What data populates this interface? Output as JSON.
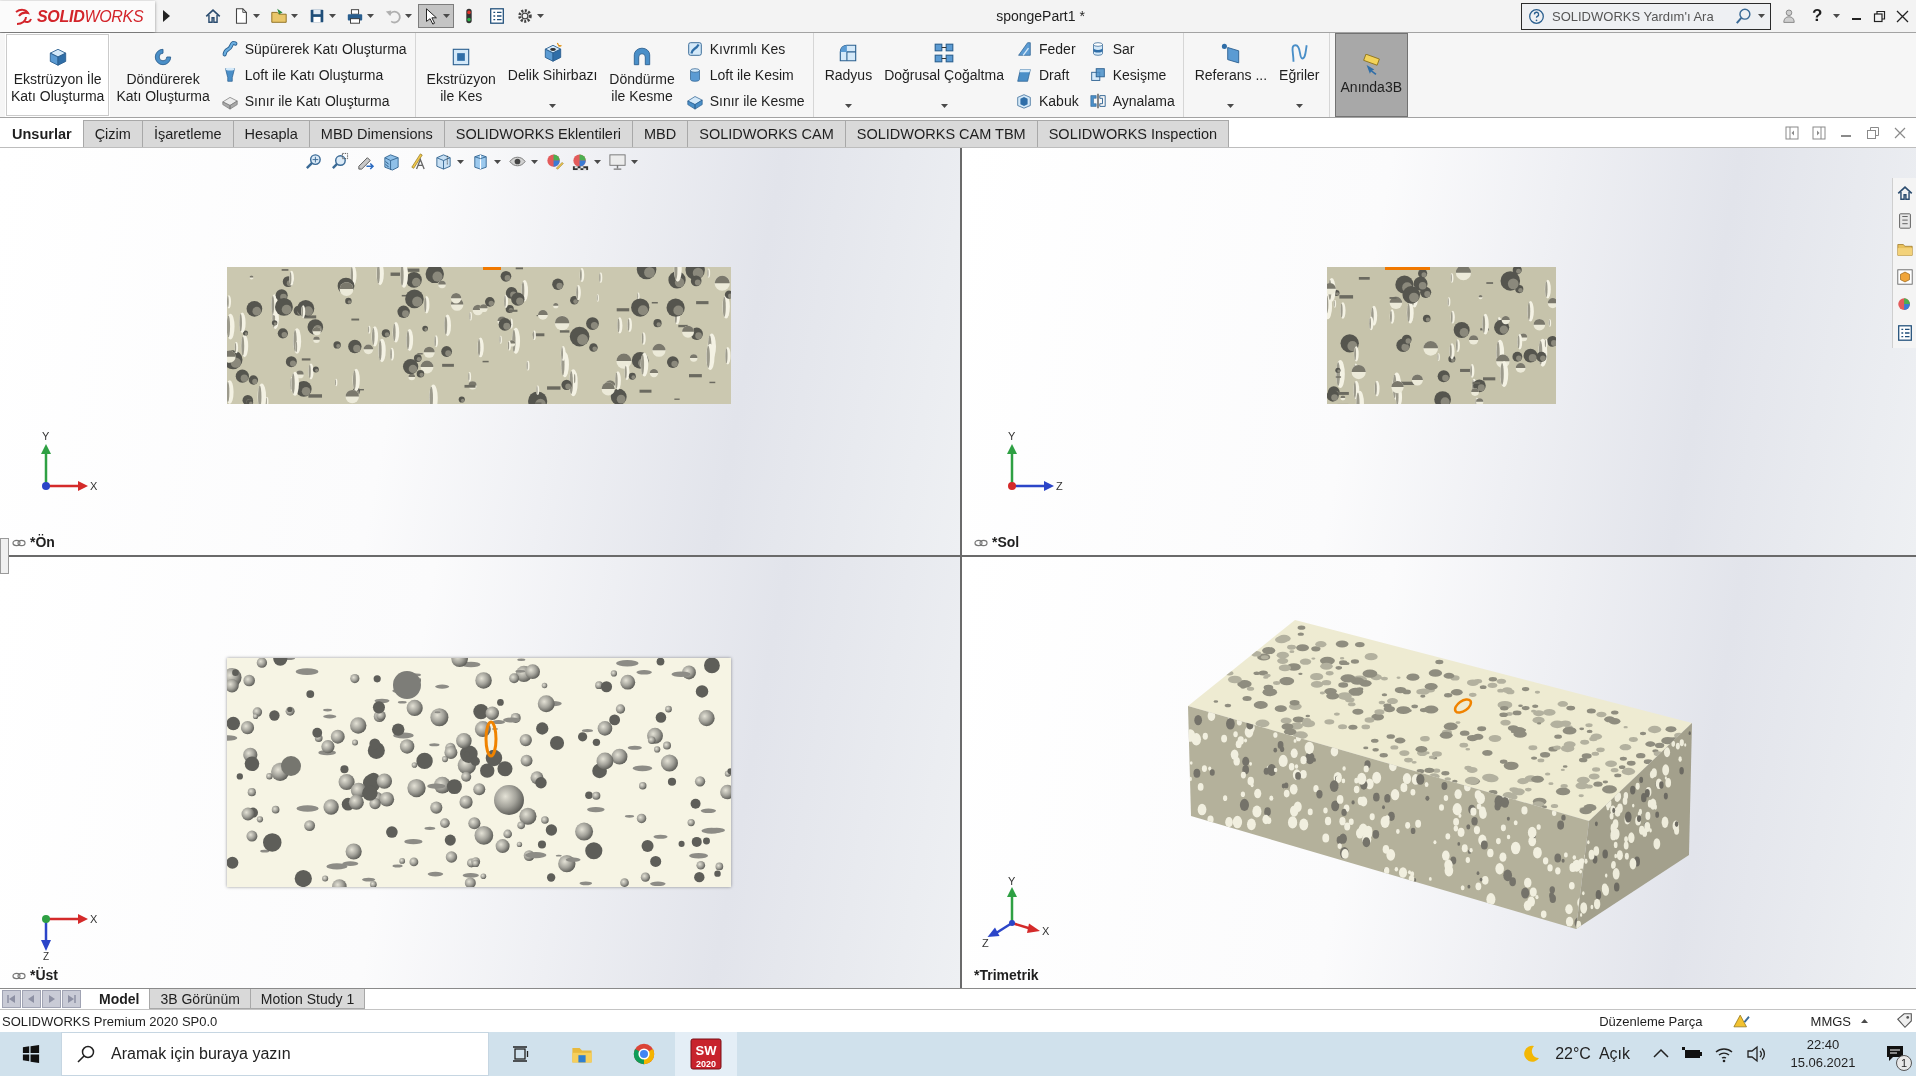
{
  "title_bar": {
    "logo": "**SOLID**WORKS",
    "quick_access": [
      {
        "dropdown": false,
        "disabled": false,
        "selected": false
      },
      {
        "dropdown": true,
        "disabled": false,
        "selected": false
      },
      {
        "dropdown": true,
        "disabled": false,
        "selected": false
      },
      {
        "dropdown": true,
        "disabled": false,
        "selected": false
      },
      {
        "dropdown": true,
        "disabled": false,
        "selected": false
      },
      {
        "dropdown": true,
        "disabled": true,
        "selected": false
      },
      {
        "dropdown": true,
        "disabled": false,
        "selected": true
      },
      {
        "dropdown": false,
        "disabled": false,
        "selected": false
      },
      {
        "dropdown": false,
        "disabled": false,
        "selected": false
      },
      {
        "dropdown": true,
        "disabled": false,
        "selected": false
      }
    ],
    "title": "spongePart1 *",
    "search": {
      "placeholder": "SOLIDWORKS Yardım'ı Ara"
    },
    "help": "?"
  },
  "ribbon": {
    "groups": [
      {
        "items": [
          {
            "kind": "large",
            "label": "Ekstrüzyon İle\nKatı Oluşturma",
            "hovered": true,
            "pressed": false,
            "dropdown": false
          },
          {
            "kind": "large",
            "label": "Döndürerek\nKatı Oluşturma",
            "hovered": false,
            "pressed": false,
            "dropdown": false
          },
          {
            "kind": "stack",
            "buttons": [
              "Süpürerek Katı Oluşturma",
              "Loft ile Katı Oluşturma",
              "Sınır ile Katı Oluşturma"
            ]
          }
        ]
      },
      {
        "items": [
          {
            "kind": "large",
            "label": "Ekstrüzyon\nile Kes",
            "hovered": false,
            "pressed": false,
            "dropdown": false
          },
          {
            "kind": "large",
            "label": "Delik Sihirbazı",
            "hovered": false,
            "pressed": false,
            "dropdown": true
          },
          {
            "kind": "large",
            "label": "Döndürme\nile Kesme",
            "hovered": false,
            "pressed": false,
            "dropdown": false
          },
          {
            "kind": "stack",
            "buttons": [
              "Kıvrımlı Kes",
              "Loft ile Kesim",
              "Sınır ile Kesme"
            ]
          }
        ]
      },
      {
        "items": [
          {
            "kind": "large",
            "label": "Radyus",
            "hovered": false,
            "pressed": false,
            "dropdown": true
          },
          {
            "kind": "large",
            "label": "Doğrusal Çoğaltma",
            "hovered": false,
            "pressed": false,
            "dropdown": true
          },
          {
            "kind": "stack",
            "buttons": [
              "Feder",
              "Draft",
              "Kabuk"
            ]
          },
          {
            "kind": "stack",
            "buttons": [
              "Sar",
              "Kesişme",
              "Aynalama"
            ]
          }
        ]
      },
      {
        "items": [
          {
            "kind": "large",
            "label": "Referans ...",
            "hovered": false,
            "pressed": false,
            "dropdown": true
          },
          {
            "kind": "large",
            "label": "Eğriler",
            "hovered": false,
            "pressed": false,
            "dropdown": true
          }
        ]
      },
      {
        "items": [
          {
            "kind": "large",
            "label": "Anında3B",
            "hovered": false,
            "pressed": true,
            "dropdown": false
          }
        ]
      }
    ]
  },
  "tabs": [
    {
      "label": "Unsurlar",
      "selected": true
    },
    {
      "label": "Çizim",
      "selected": false
    },
    {
      "label": "İşaretleme",
      "selected": false
    },
    {
      "label": "Hesapla",
      "selected": false
    },
    {
      "label": "MBD Dimensions",
      "selected": false
    },
    {
      "label": "SOLIDWORKS Eklentileri",
      "selected": false
    },
    {
      "label": "MBD",
      "selected": false
    },
    {
      "label": "SOLIDWORKS CAM",
      "selected": false
    },
    {
      "label": "SOLIDWORKS CAM TBM",
      "selected": false
    },
    {
      "label": "SOLIDWORKS Inspection",
      "selected": false
    }
  ],
  "view_toolbar": [
    {
      "dropdown": false
    },
    {
      "dropdown": false
    },
    {
      "dropdown": false
    },
    {
      "dropdown": false
    },
    {
      "dropdown": false
    },
    {
      "dropdown": true
    },
    {
      "dropdown": true
    },
    {
      "dropdown": true
    },
    {
      "dropdown": false
    },
    {
      "dropdown": true
    },
    {
      "dropdown": true
    }
  ],
  "viewports": [
    {
      "kind": "front",
      "label": "*Ön",
      "linked": true,
      "axes": [
        "Y",
        "X"
      ]
    },
    {
      "kind": "left",
      "label": "*Sol",
      "linked": true,
      "axes": [
        "Y",
        "Z"
      ]
    },
    {
      "kind": "top",
      "label": "*Üst",
      "linked": true,
      "axes": [
        "X",
        "Z"
      ]
    },
    {
      "kind": "trimetric",
      "label": "*Trimetrik",
      "linked": false,
      "axes": [
        "Y",
        "X",
        "Z"
      ]
    }
  ],
  "bottom_tabs": [
    {
      "label": "Model",
      "selected": true
    },
    {
      "label": "3B Görünüm",
      "selected": false
    },
    {
      "label": "Motion Study 1",
      "selected": false
    }
  ],
  "status_bar": {
    "version": "SOLIDWORKS Premium 2020 SP0.0",
    "mode": "Düzenleme Parça",
    "units": "MMGS"
  },
  "taskbar": {
    "search": {
      "placeholder": "Aramak için buraya yazın"
    },
    "apps": [
      {
        "active": false
      },
      {
        "active": false
      },
      {
        "active": false
      },
      {
        "active": true,
        "icon_text": "SW",
        "icon_subtext": "2020"
      }
    ],
    "weather": {
      "temperature": "22°C",
      "condition": "Açık"
    },
    "time": "22:40",
    "date": "15.06.2021",
    "notifications": "1"
  }
}
